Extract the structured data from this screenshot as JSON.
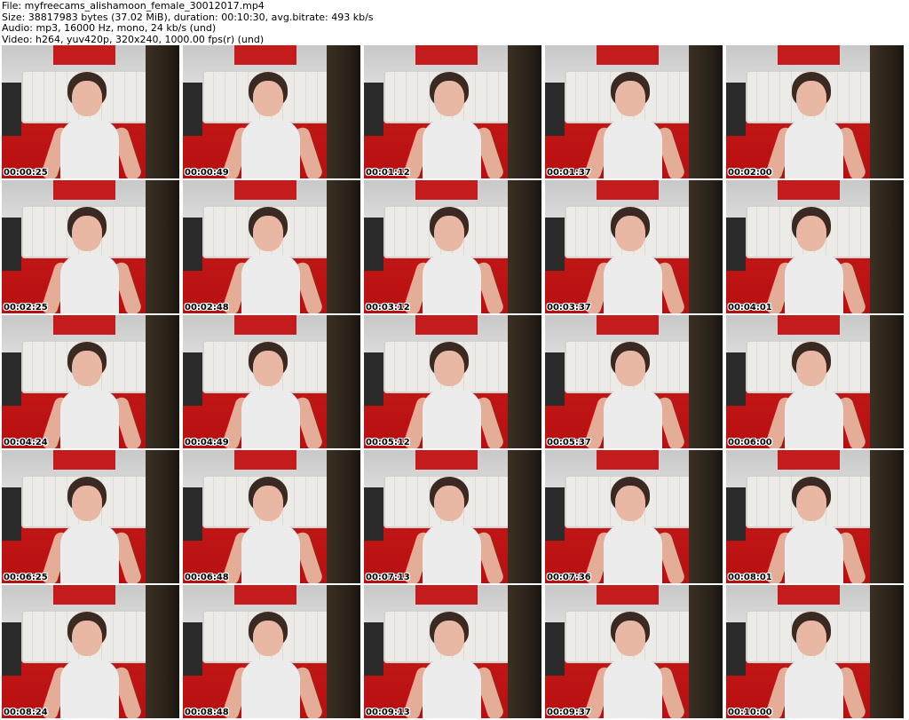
{
  "header": {
    "file": "File: myfreecams_alishamoon_female_30012017.mp4",
    "size": "Size: 38817983 bytes (37.02 MiB), duration: 00:10:30, avg.bitrate: 493 kb/s",
    "audio": "Audio: mp3, 16000 Hz, mono, 24 kb/s (und)",
    "video": "Video: h264, yuv420p, 320x240, 1000.00 fps(r) (und)"
  },
  "thumbnails": [
    {
      "timestamp": "00:00:25"
    },
    {
      "timestamp": "00:00:49"
    },
    {
      "timestamp": "00:01:12"
    },
    {
      "timestamp": "00:01:37"
    },
    {
      "timestamp": "00:02:00"
    },
    {
      "timestamp": "00:02:25"
    },
    {
      "timestamp": "00:02:48"
    },
    {
      "timestamp": "00:03:12"
    },
    {
      "timestamp": "00:03:37"
    },
    {
      "timestamp": "00:04:01"
    },
    {
      "timestamp": "00:04:24"
    },
    {
      "timestamp": "00:04:49"
    },
    {
      "timestamp": "00:05:12"
    },
    {
      "timestamp": "00:05:37"
    },
    {
      "timestamp": "00:06:00"
    },
    {
      "timestamp": "00:06:25"
    },
    {
      "timestamp": "00:06:48"
    },
    {
      "timestamp": "00:07:13"
    },
    {
      "timestamp": "00:07:36"
    },
    {
      "timestamp": "00:08:01"
    },
    {
      "timestamp": "00:08:24"
    },
    {
      "timestamp": "00:08:48"
    },
    {
      "timestamp": "00:09:13"
    },
    {
      "timestamp": "00:09:37"
    },
    {
      "timestamp": "00:10:00"
    }
  ]
}
